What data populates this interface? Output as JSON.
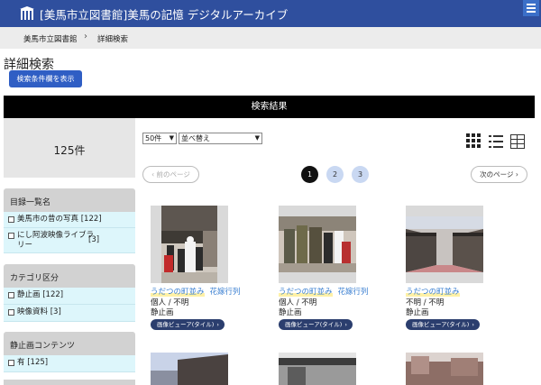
{
  "header": {
    "site_title": "[美馬市立図書館]美馬の記憶 デジタルアーカイブ",
    "logo_icon": "library-building-icon",
    "menu_icon": "hamburger-menu-icon"
  },
  "breadcrumb": {
    "home": "美馬市立図書館",
    "separator": "›",
    "current": "詳細検索"
  },
  "page": {
    "heading": "詳細検索",
    "show_conditions_button": "検索条件欄を表示",
    "results_header": "検索結果"
  },
  "sidebar": {
    "count": "125件",
    "facets": [
      {
        "title": "目録一覧名",
        "items": [
          {
            "label": "美馬市の昔の写真",
            "count": "[122]"
          },
          {
            "label": "にし阿波映像ライブラリー",
            "count": "[3]"
          }
        ]
      },
      {
        "title": "カテゴリ区分",
        "items": [
          {
            "label": "静止画",
            "count": "[122]"
          },
          {
            "label": "映像資料",
            "count": "[3]"
          }
        ]
      },
      {
        "title": "静止画コンテンツ",
        "items": [
          {
            "label": "有",
            "count": "[125]"
          }
        ]
      }
    ]
  },
  "toolbar": {
    "per_page": "50件",
    "sort": "並べ替え",
    "view_icons": [
      "grid-view-icon",
      "list-view-icon",
      "table-view-icon"
    ]
  },
  "pagination": {
    "prev": "前のページ",
    "next": "次のページ",
    "pages": [
      "1",
      "2",
      "3"
    ],
    "current": "1"
  },
  "results": [
    {
      "title": "うだつの町並み",
      "subtitle": "花嫁行列",
      "rights": "個人 / 不明",
      "type": "静止画",
      "viewer": "画像ビューア(タイル)"
    },
    {
      "title": "うだつの町並み",
      "subtitle": "花嫁行列",
      "rights": "個人 / 不明",
      "type": "静止画",
      "viewer": "画像ビューア(タイル)"
    },
    {
      "title": "うだつの町並み",
      "subtitle": "",
      "rights": "不明 / 不明",
      "type": "静止画",
      "viewer": "画像ビューア(タイル)"
    }
  ],
  "colors": {
    "header_bg": "#2f4f9e",
    "accent_button": "#2f5ec4",
    "facet_item_bg": "#ddf6fb",
    "link": "#3a7fd1",
    "viewer_button": "#2b3e6e"
  }
}
